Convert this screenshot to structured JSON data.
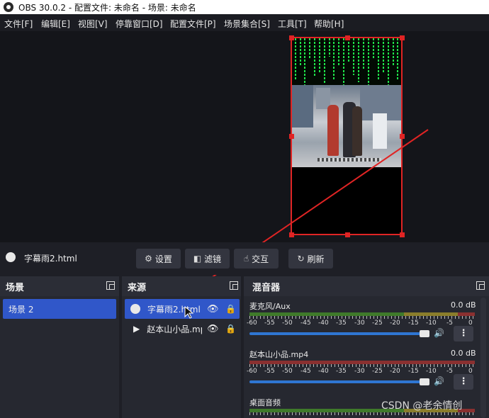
{
  "window": {
    "title": "OBS 30.0.2 - 配置文件: 未命名 - 场景: 未命名"
  },
  "menu": [
    "文件[F]",
    "编辑[E]",
    "视图[V]",
    "停靠窗口[D]",
    "配置文件[P]",
    "场景集合[S]",
    "工具[T]",
    "帮助[H]"
  ],
  "source_bar": {
    "selected_source": "字幕雨2.html"
  },
  "toolbar": {
    "settings": "设置",
    "filters": "滤镜",
    "interact": "交互",
    "refresh": "刷新"
  },
  "scenes": {
    "title": "场景",
    "items": [
      {
        "label": "场景 2",
        "selected": true
      }
    ]
  },
  "sources": {
    "title": "来源",
    "items": [
      {
        "label": "字幕雨2.html",
        "selected": true,
        "icon": "globe-icon"
      },
      {
        "label": "赵本山小品.mp4",
        "selected": false,
        "icon": "play-icon"
      }
    ]
  },
  "mixer": {
    "title": "混音器",
    "scale": [
      "-60",
      "-55",
      "-50",
      "-45",
      "-40",
      "-35",
      "-30",
      "-25",
      "-20",
      "-15",
      "-10",
      "-5",
      "0"
    ],
    "channels": [
      {
        "name": "麦克风/Aux",
        "db": "0.0 dB",
        "volume": 1.0
      },
      {
        "name": "赵本山小品.mp4",
        "db": "0.0 dB",
        "volume": 1.0
      },
      {
        "name": "桌面音频",
        "db": "",
        "volume": 1.0
      }
    ]
  },
  "watermark": "CSDN @老余情创",
  "colors": {
    "accent_selected": "#3057c9",
    "selection_red": "#e02424",
    "matrix_green": "#1fe34a"
  }
}
